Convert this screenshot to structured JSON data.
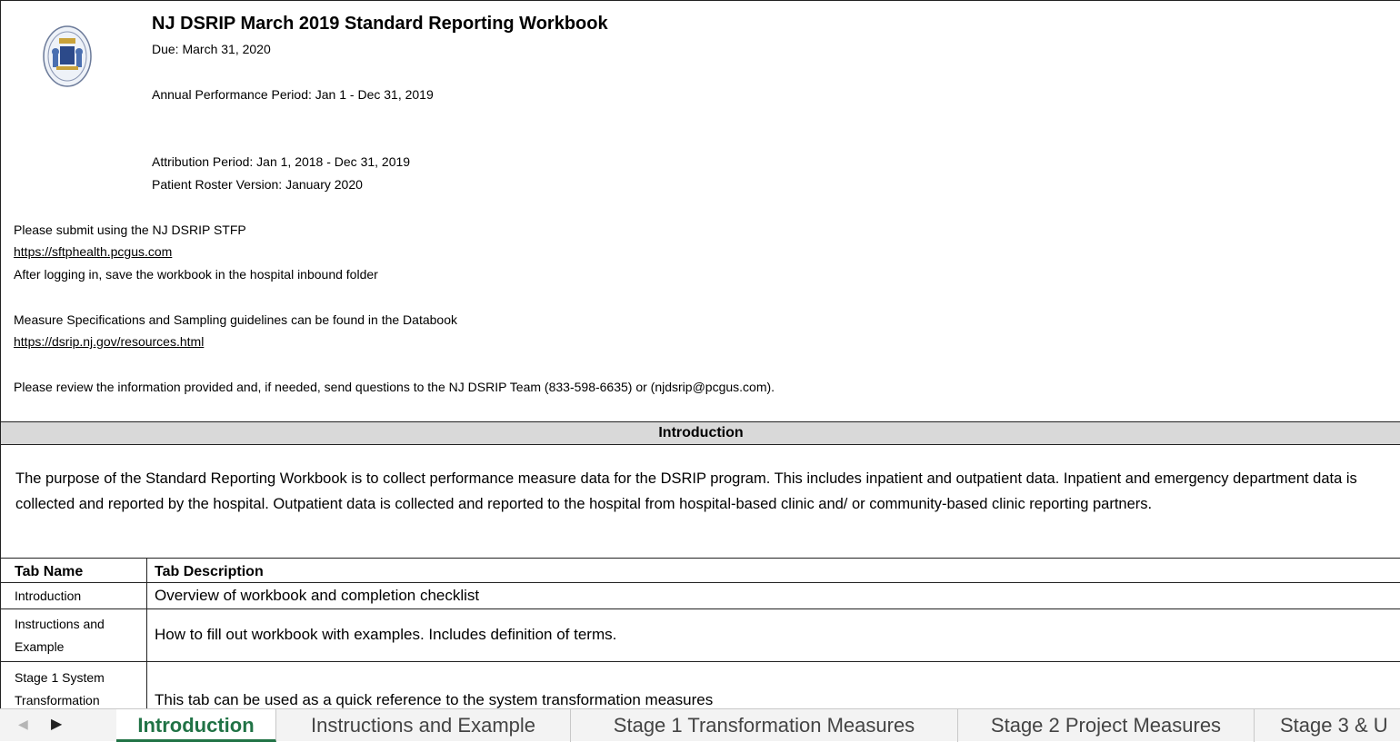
{
  "header": {
    "title": "NJ DSRIP March 2019 Standard Reporting Workbook",
    "due": "Due: March 31, 2020",
    "performance_period": "Annual Performance Period: Jan 1 - Dec 31, 2019",
    "attribution_period": "Attribution Period: Jan 1, 2018 - Dec 31, 2019",
    "roster_version": "Patient Roster Version: January  2020"
  },
  "submission": {
    "line1": "Please submit using the NJ DSRIP STFP",
    "link1": "https://sftphealth.pcgus.com",
    "line2": "After logging in, save the workbook in the hospital inbound folder",
    "line3": "Measure Specifications and Sampling guidelines can be found in the Databook",
    "link2": "https://dsrip.nj.gov/resources.html",
    "line4": "Please review the information provided and, if needed, send questions to the NJ DSRIP Team (833-598-6635) or (njdsrip@pcgus.com)."
  },
  "introduction": {
    "heading": "Introduction",
    "text": "The purpose of the Standard Reporting Workbook is to collect performance measure data for the DSRIP program. This includes inpatient and outpatient data. Inpatient and emergency department data is collected and reported by the hospital. Outpatient data is collected and reported to the hospital from hospital-based clinic and/ or community-based clinic reporting partners."
  },
  "table": {
    "headers": [
      "Tab Name",
      "Tab Description"
    ],
    "rows": [
      {
        "name": "Introduction",
        "description": "Overview of workbook and completion checklist"
      },
      {
        "name_line1": "Instructions and",
        "name_line2": "Example",
        "description": "How to fill out workbook with examples. Includes definition of terms."
      },
      {
        "name_line1": "Stage 1 System",
        "name_line2": "Transformation",
        "description": "This tab can be used as a quick reference to the system transformation measures"
      }
    ]
  },
  "tabs": [
    {
      "label": "Introduction",
      "active": true
    },
    {
      "label": "Instructions and Example"
    },
    {
      "label": "Stage 1 Transformation Measures"
    },
    {
      "label": "Stage 2 Project Measures"
    },
    {
      "label": "Stage 3 & U"
    }
  ],
  "colors": {
    "accent": "#217346",
    "header_fill": "#d9d9d9"
  }
}
